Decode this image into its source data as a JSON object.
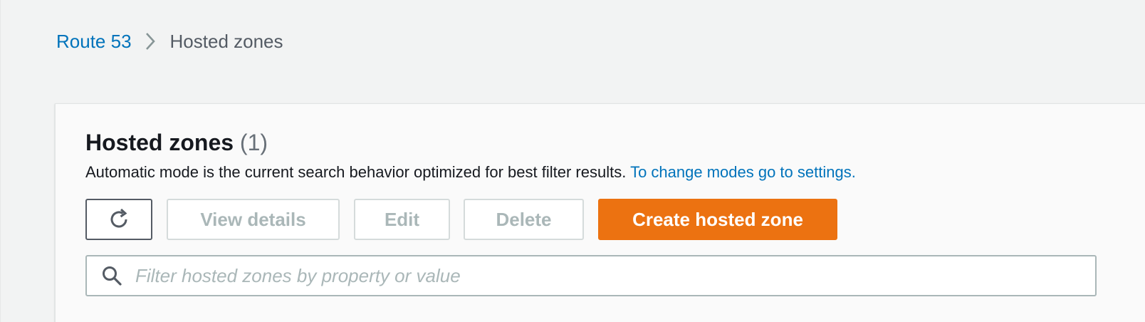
{
  "breadcrumb": {
    "root_label": "Route 53",
    "current_label": "Hosted zones"
  },
  "panel": {
    "title": "Hosted zones",
    "count": "(1)",
    "description": "Automatic mode is the current search behavior optimized for best filter results.",
    "settings_link": "To change modes go to settings."
  },
  "toolbar": {
    "refresh_icon": "refresh-icon",
    "view_details_label": "View details",
    "edit_label": "Edit",
    "delete_label": "Delete",
    "create_label": "Create hosted zone"
  },
  "search": {
    "icon": "search-icon",
    "placeholder": "Filter hosted zones by property or value",
    "value": ""
  },
  "colors": {
    "link": "#0073bb",
    "primary_button": "#ec7211",
    "disabled_text": "#aab7b8",
    "background": "#f2f3f3"
  }
}
